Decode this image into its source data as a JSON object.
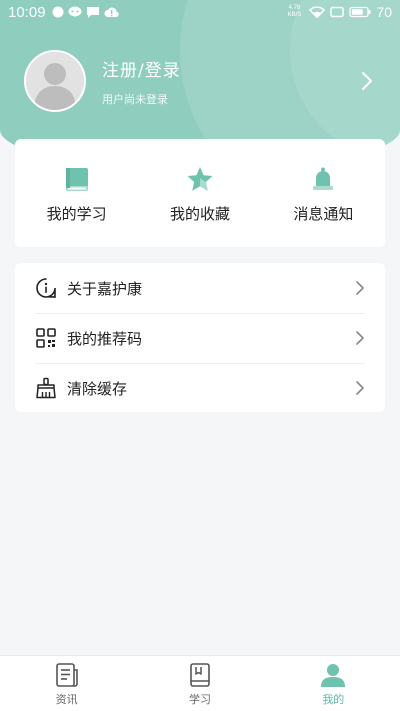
{
  "status_bar": {
    "time": "10:09",
    "net_speed_value": "4.78",
    "net_speed_unit": "KB/S",
    "battery": "70"
  },
  "profile": {
    "login_label": "注册/登录",
    "subtitle": "用户尚未登录"
  },
  "quick_actions": [
    {
      "label": "我的学习",
      "icon": "book-icon"
    },
    {
      "label": "我的收藏",
      "icon": "star-icon"
    },
    {
      "label": "消息通知",
      "icon": "bell-icon"
    }
  ],
  "menu": [
    {
      "label": "关于嘉护康",
      "icon": "info-icon"
    },
    {
      "label": "我的推荐码",
      "icon": "qr-code-icon"
    },
    {
      "label": "清除缓存",
      "icon": "broom-icon"
    }
  ],
  "bottom_nav": [
    {
      "label": "资讯",
      "icon": "news-icon",
      "active": false
    },
    {
      "label": "学习",
      "icon": "study-icon",
      "active": false
    },
    {
      "label": "我的",
      "icon": "user-icon",
      "active": true
    }
  ],
  "colors": {
    "header": "#8fcdbf",
    "accent": "#5fb9a7",
    "background": "#f5f6f7"
  }
}
